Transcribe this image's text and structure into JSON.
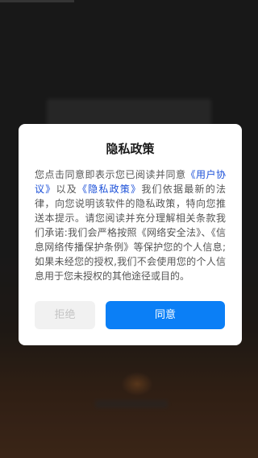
{
  "dialog": {
    "title": "隐私政策",
    "body": {
      "text_1": "您点击同意即表示您已阅读并同意",
      "link_user_agreement": "《用户协议》",
      "text_2": "以及",
      "link_privacy_policy": "《隐私政策》",
      "text_3": "我们依据最新的法律，向您说明该软件的隐私政策，特向您推送本提示。请您阅读并充分理解相关条款我们承诺:我们会严格按照《网络安全法》、《信息网络传播保护条例》等保护您的个人信息;如果未经您的授权,我们不会使用您的个人信息用于您未授权的其他途径或目的。"
    },
    "buttons": {
      "reject_label": "拒绝",
      "agree_label": "同意"
    }
  },
  "colors": {
    "link": "#1a4fd8",
    "primary_button": "#0b7ff6",
    "disabled_button": "#f1f1f1",
    "overlay": "rgba(0,0,0,0.35)"
  }
}
